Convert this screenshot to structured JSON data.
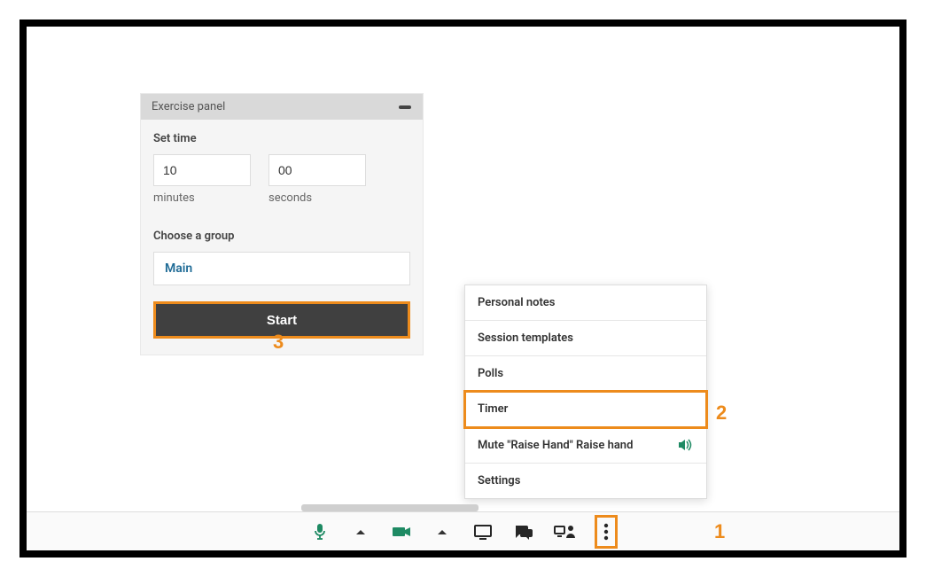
{
  "exercisePanel": {
    "title": "Exercise panel",
    "setTimeLabel": "Set time",
    "minutesValue": "10",
    "secondsValue": "00",
    "minutesLabel": "minutes",
    "secondsLabel": "seconds",
    "chooseGroupLabel": "Choose a group",
    "groupValue": "Main",
    "startLabel": "Start"
  },
  "menu": {
    "items": [
      {
        "label": "Personal notes"
      },
      {
        "label": "Session templates"
      },
      {
        "label": "Polls"
      },
      {
        "label": "Timer"
      },
      {
        "label": "Mute \"Raise Hand\" Raise hand"
      },
      {
        "label": "Settings"
      }
    ]
  },
  "annotations": {
    "one": "1",
    "two": "2",
    "three": "3"
  },
  "colors": {
    "accent": "#ed8b1c",
    "green": "#1e8a63"
  }
}
